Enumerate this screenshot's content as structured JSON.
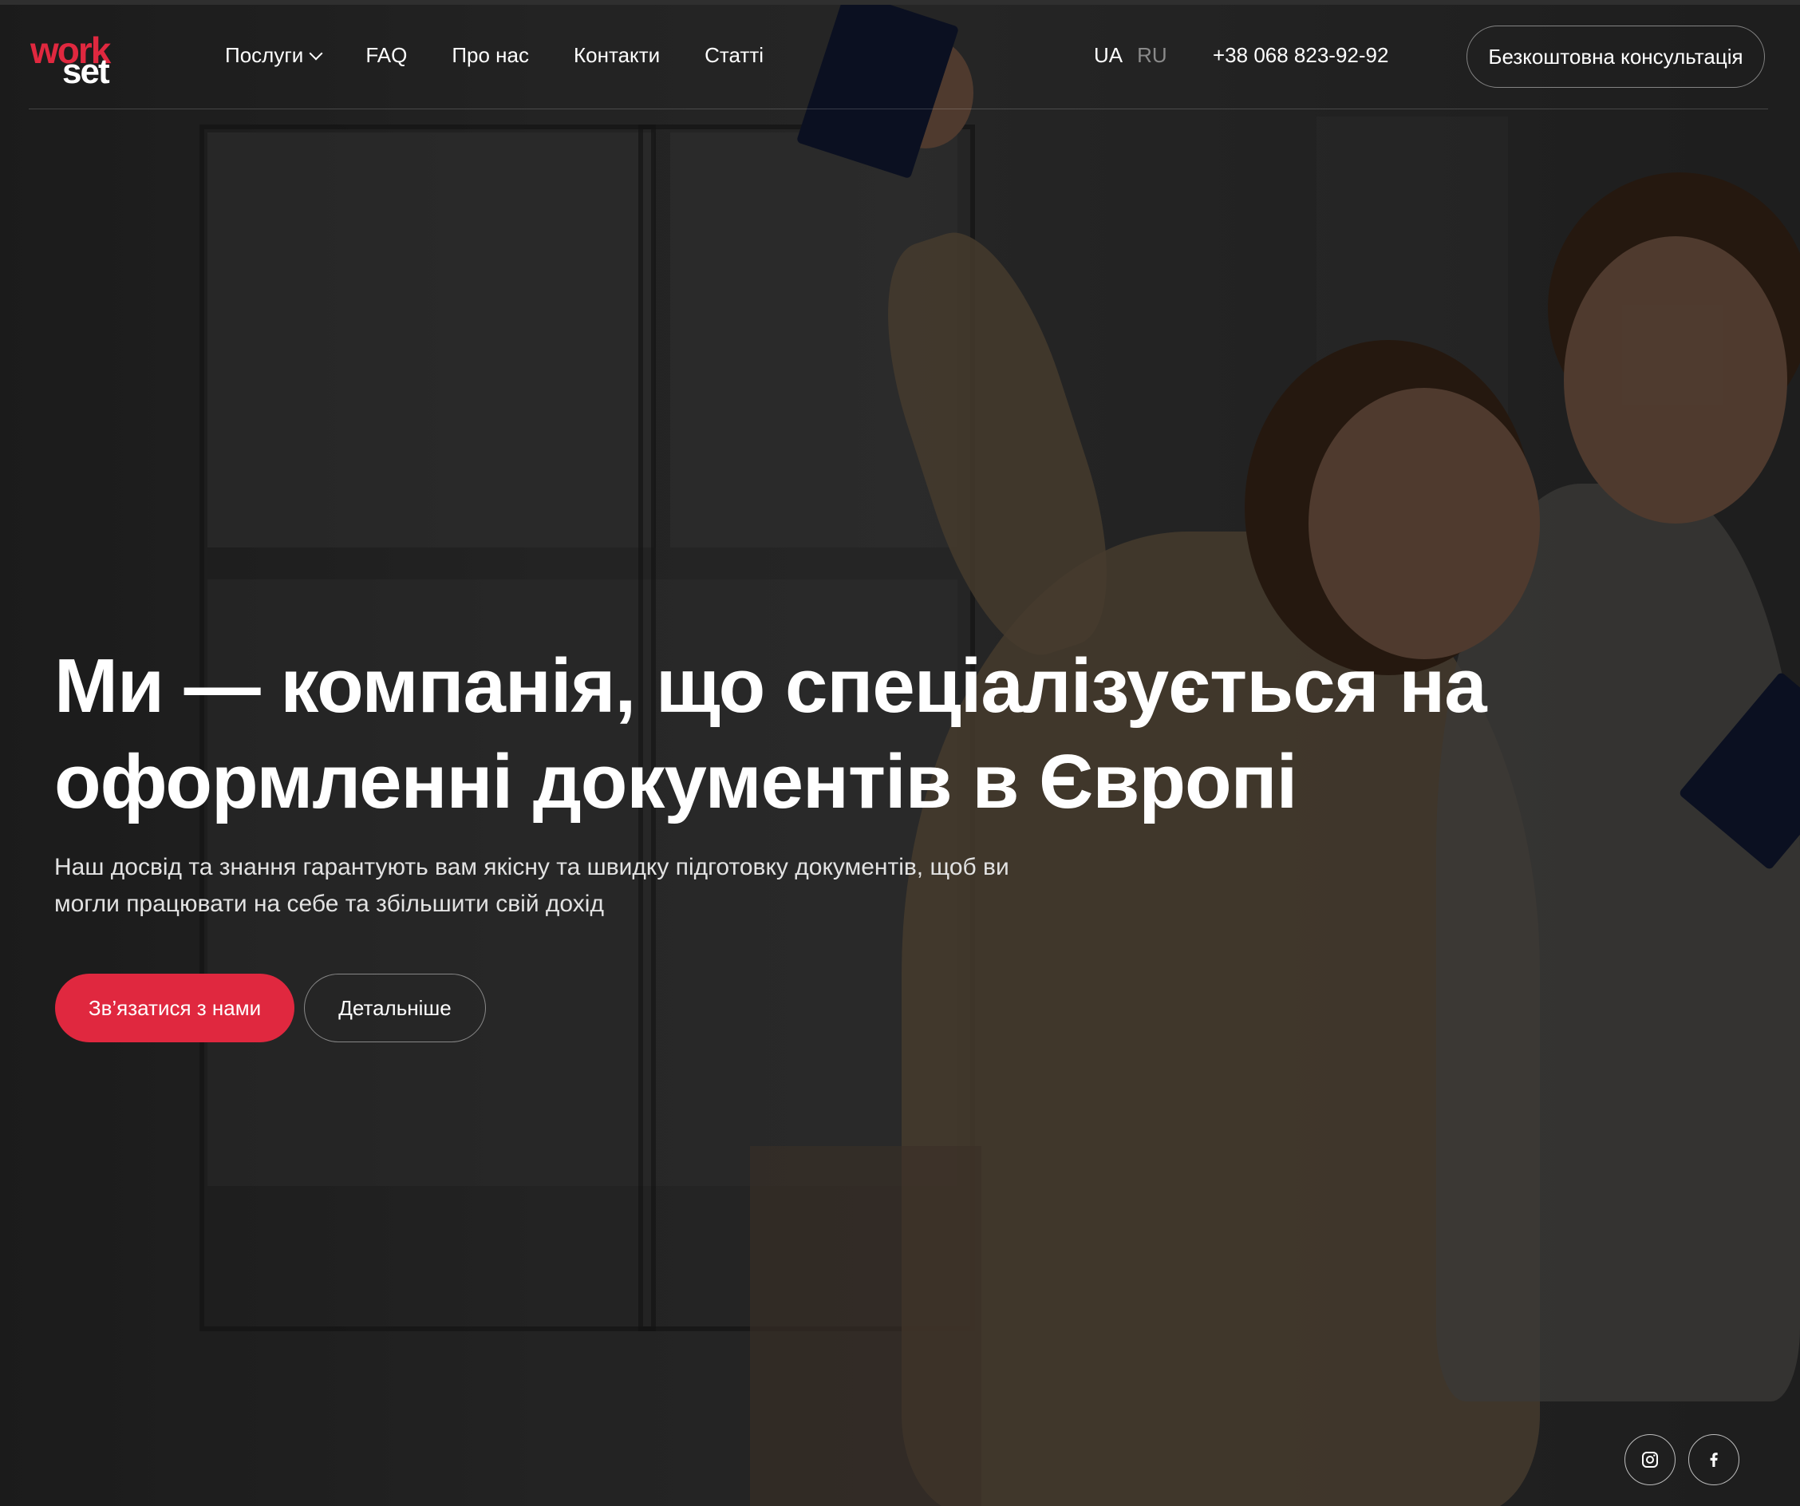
{
  "header": {
    "logo": {
      "top": "work",
      "bottom": "set"
    },
    "nav": [
      {
        "label": "Послуги",
        "has_dropdown": true
      },
      {
        "label": "FAQ"
      },
      {
        "label": "Про нас"
      },
      {
        "label": "Контакти"
      },
      {
        "label": "Статті"
      }
    ],
    "languages": {
      "active": "UA",
      "inactive": "RU"
    },
    "phone": "+38 068 823-92-92",
    "cta_label": "Безкоштовна консультація"
  },
  "hero": {
    "title_line1": "Ми — компанія, що спеціалізується на",
    "title_line2": "оформленні документів в Європі",
    "subtitle_line1": "Наш досвід та знання гарантують вам якісну та швидку підготовку документів, щоб ви",
    "subtitle_line2": "могли працювати на себе та збільшити свій дохід",
    "primary_button": "Зв’язатися з нами",
    "secondary_button": "Детальніше"
  },
  "socials": [
    {
      "icon": "instagram-icon"
    },
    {
      "icon": "facebook-icon"
    }
  ],
  "colors": {
    "accent": "#e0283f",
    "background": "#1c1c1c",
    "text": "#ffffff"
  }
}
